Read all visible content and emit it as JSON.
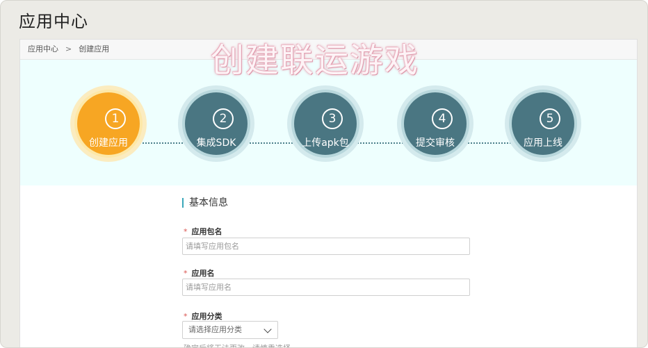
{
  "header": {
    "title": "应用中心"
  },
  "breadcrumb": {
    "root": "应用中心",
    "separator": ">",
    "current": "创建应用"
  },
  "overlay": {
    "text": "创建联运游戏"
  },
  "steps": [
    {
      "number": "1",
      "label": "创建应用",
      "state": "active"
    },
    {
      "number": "2",
      "label": "集成SDK",
      "state": "inactive"
    },
    {
      "number": "3",
      "label": "上传apk包",
      "state": "inactive"
    },
    {
      "number": "4",
      "label": "提交审核",
      "state": "inactive"
    },
    {
      "number": "5",
      "label": "应用上线",
      "state": "inactive"
    }
  ],
  "form": {
    "section_title": "基本信息",
    "required_mark": "*",
    "package_name": {
      "label": "应用包名",
      "placeholder": "请填写应用包名"
    },
    "app_name": {
      "label": "应用名",
      "placeholder": "请填写应用名"
    },
    "category": {
      "label": "应用分类",
      "selected": "请选择应用分类"
    },
    "hint": "确定后将无法更改，请慎重选择"
  },
  "colors": {
    "active_step": "#f7a623",
    "inactive_step": "#4a7682",
    "steps_bg": "#eefffe",
    "required": "#d9534f",
    "section_accent": "#3aa7b9"
  }
}
